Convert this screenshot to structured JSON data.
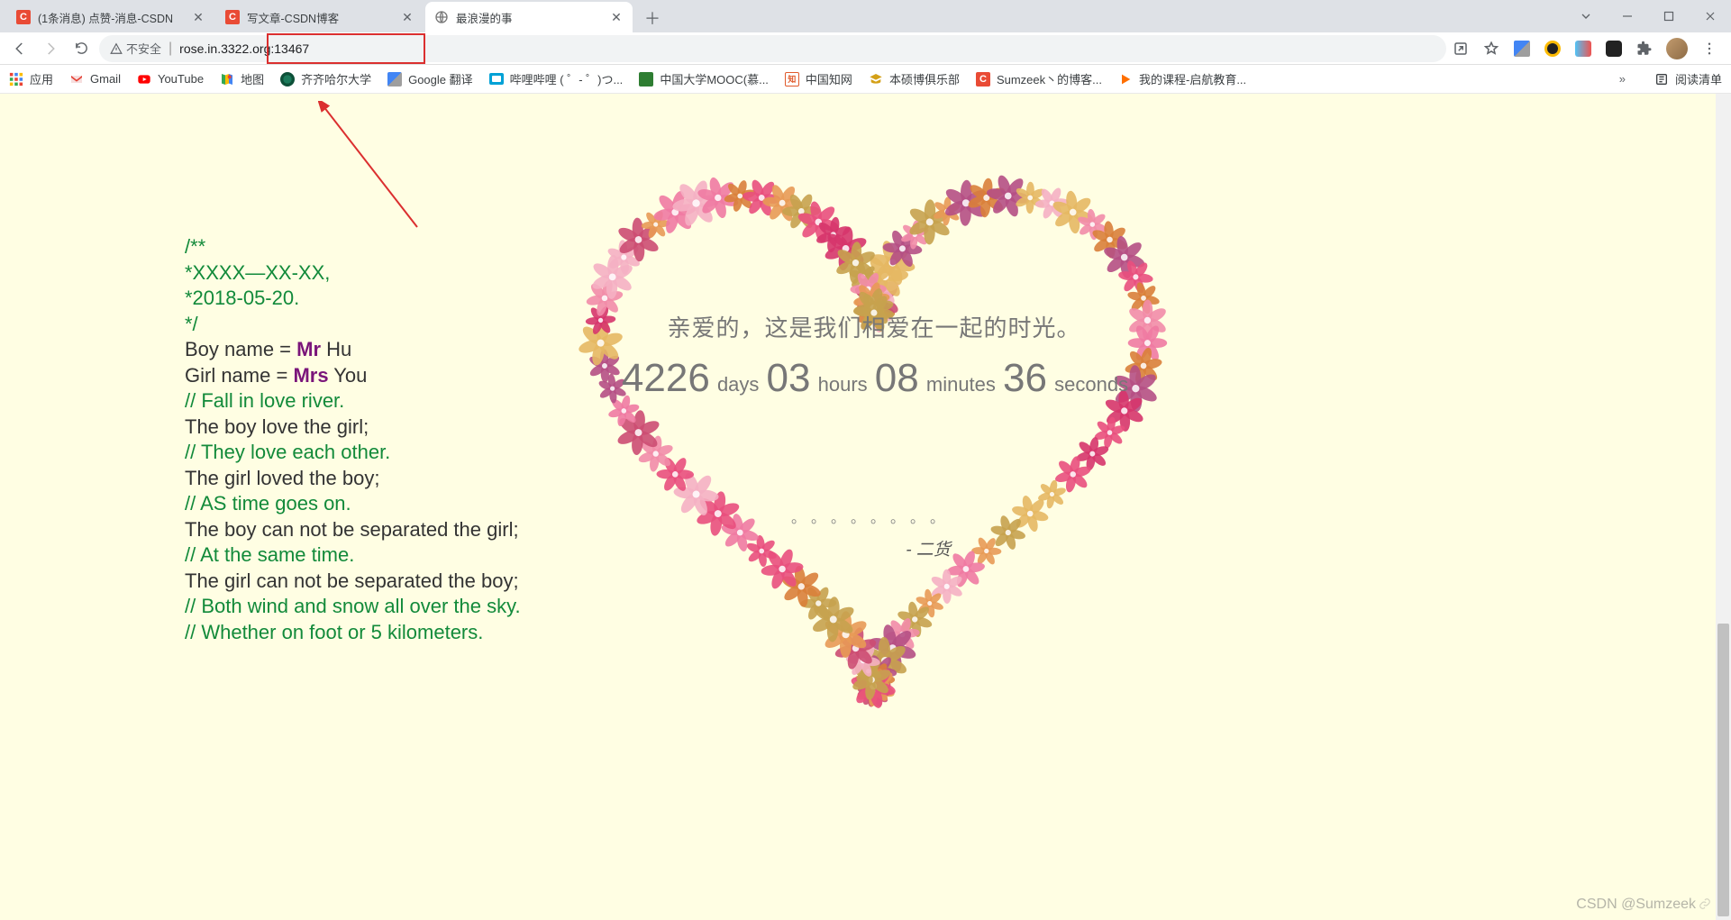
{
  "tabs": [
    {
      "title": "(1条消息) 点赞-消息-CSDN",
      "favicon": "C"
    },
    {
      "title": "写文章-CSDN博客",
      "favicon": "C"
    },
    {
      "title": "最浪漫的事",
      "favicon": "globe",
      "active": true
    }
  ],
  "addr": {
    "warn_label": "不安全",
    "url": "rose.in.3322.org:13467"
  },
  "bookmarks": [
    {
      "label": "应用",
      "icon": "apps"
    },
    {
      "label": "Gmail",
      "icon": "gmail"
    },
    {
      "label": "YouTube",
      "icon": "youtube"
    },
    {
      "label": "地图",
      "icon": "maps"
    },
    {
      "label": "齐齐哈尔大学",
      "icon": "qqhe"
    },
    {
      "label": "Google 翻译",
      "icon": "gtrans"
    },
    {
      "label": "哔哩哔哩 (  ゜-  ゜)つ...",
      "icon": "bili"
    },
    {
      "label": "中国大学MOOC(慕...",
      "icon": "mooc"
    },
    {
      "label": "中国知网",
      "icon": "cnki"
    },
    {
      "label": "本硕博俱乐部",
      "icon": "club"
    },
    {
      "label": "Sumzeek丶的博客...",
      "icon": "csdn"
    },
    {
      "label": "我的课程-启航教育...",
      "icon": "qihang"
    }
  ],
  "bookbar_overflow": "»",
  "reading_list": "阅读清单",
  "code": {
    "c1": "/**",
    "c2": " *XXXX—XX-XX,",
    "c3": " *2018-05-20.",
    "c4": " */",
    "l1a": "Boy name = ",
    "l1k": "Mr",
    "l1b": " Hu",
    "l2a": "Girl name = ",
    "l2k": "Mrs",
    "l2b": " You",
    "c5": "// Fall in love river.",
    "l3": "The boy love the girl;",
    "c6": "// They love each other.",
    "l4": "The girl loved the boy;",
    "c7": "// AS time goes on.",
    "l5": "The boy can not be separated the girl;",
    "c8": "// At the same time.",
    "l6": "The girl can not be separated the boy;",
    "c9": "// Both wind and snow all over the sky.",
    "c10": "// Whether on foot or 5 kilometers."
  },
  "heart": {
    "headline": "亲爱的，这是我们相爱在一起的时光。",
    "days": "4226",
    "days_u": "days",
    "hours": "03",
    "hours_u": "hours",
    "minutes": "08",
    "minutes_u": "minutes",
    "seconds": "36",
    "seconds_u": "seconds",
    "dots": "。。。。。。。。",
    "sig": "- 二货"
  },
  "watermark": "CSDN @Sumzeek"
}
